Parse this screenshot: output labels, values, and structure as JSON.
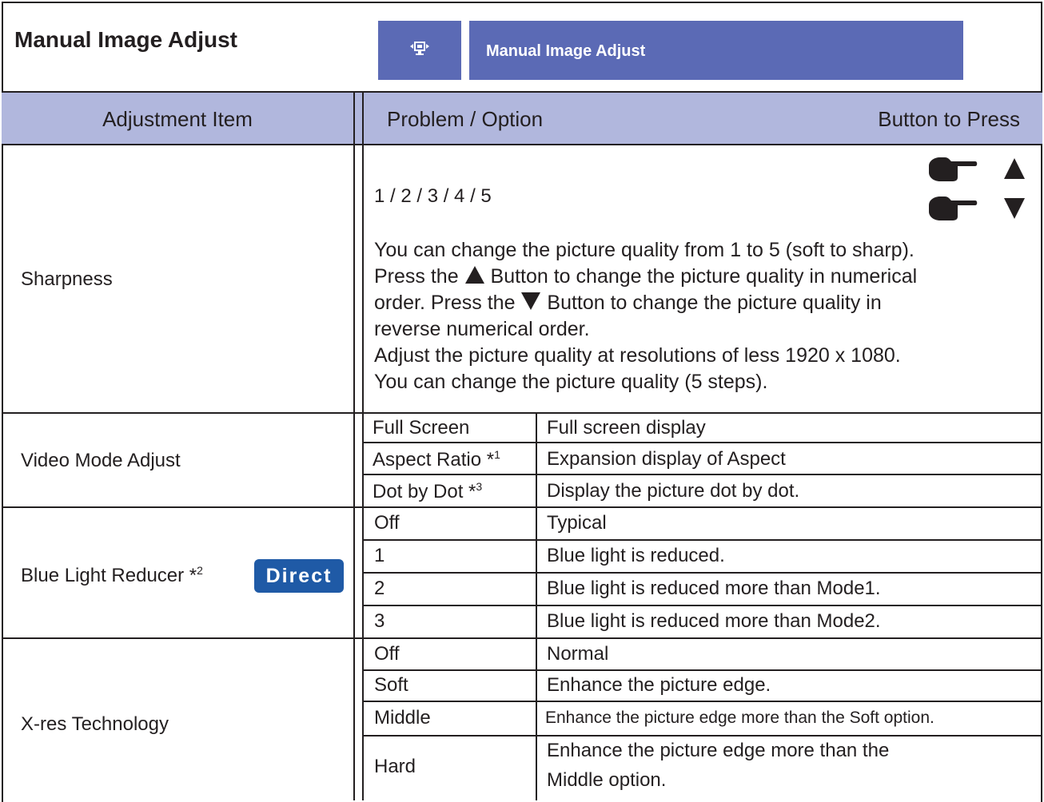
{
  "header": {
    "title": "Manual Image Adjust",
    "osd_title": "Manual Image Adjust",
    "osd_icon": "monitor-adjust-icon",
    "osd_color": "#5b6ab5"
  },
  "table": {
    "header_color": "#b1b7dd",
    "col_item": "Adjustment Item",
    "col_option": "Problem / Option",
    "col_button": "Button to Press"
  },
  "sharpness": {
    "label": "Sharpness",
    "options": "1 / 2 / 3 / 4 / 5",
    "buttons": [
      "hand-pointer-icon",
      "up-triangle-icon",
      "hand-pointer-icon",
      "down-triangle-icon"
    ],
    "line1": "You can change the picture quality from 1 to 5 (soft to sharp).",
    "line2a": "Press the",
    "line2b": "Button to change the picture quality in numerical",
    "line3a": "order. Press the",
    "line3b": "Button to change the picture quality in",
    "line4": "reverse numerical order.",
    "line5": "Adjust the picture quality at resolutions of less 1920 x 1080.",
    "line6": "You can change the picture quality (5 steps)."
  },
  "video_mode": {
    "label": "Video Mode Adjust",
    "rows": [
      {
        "option": "Full Screen",
        "sup": "",
        "desc": "Full screen display"
      },
      {
        "option": "Aspect Ratio *",
        "sup": "1",
        "desc": "Expansion display of Aspect"
      },
      {
        "option": "Dot by Dot *",
        "sup": "3",
        "desc": "Display the picture dot by dot."
      }
    ]
  },
  "blue_light": {
    "label": "Blue Light Reducer *",
    "sup": "2",
    "badge": "Direct",
    "badge_color": "#1f5aa6",
    "rows": [
      {
        "option": "Off",
        "desc": "Typical"
      },
      {
        "option": "1",
        "desc": "Blue light is reduced."
      },
      {
        "option": "2",
        "desc": "Blue light is reduced more than Mode1."
      },
      {
        "option": "3",
        "desc": "Blue light is reduced more than Mode2."
      }
    ]
  },
  "xres": {
    "label": "X-res Technology",
    "rows": [
      {
        "option": "Off",
        "desc": "Normal"
      },
      {
        "option": "Soft",
        "desc": "Enhance the picture edge."
      },
      {
        "option": "Middle",
        "desc": "Enhance the picture edge more than the Soft option."
      },
      {
        "option": "Hard",
        "desc": "Enhance the picture edge more than the",
        "desc2": "Middle option."
      }
    ]
  }
}
